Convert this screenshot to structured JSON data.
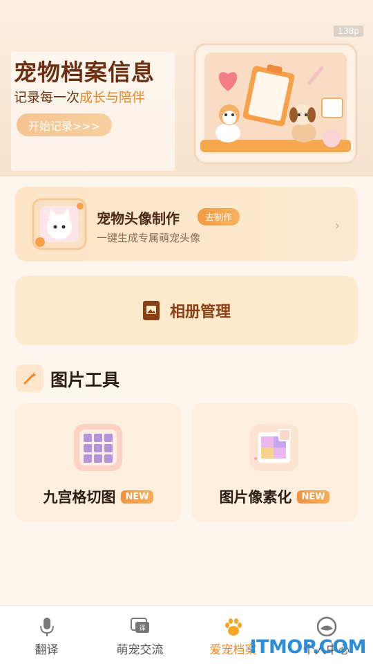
{
  "status": {
    "resolution_badge": "138p"
  },
  "hero": {
    "title": "宠物档案信息",
    "subtitle_prefix": "记录每一次",
    "subtitle_highlight": "成长与陪伴",
    "start_button": "开始记录>>>"
  },
  "avatar_card": {
    "title": "宠物头像制作",
    "tag": "去制作",
    "description": "一键生成专属萌宠头像"
  },
  "album": {
    "label": "相册管理"
  },
  "tools": {
    "title": "图片工具",
    "items": [
      {
        "name": "九宫格切图",
        "badge": "NEW"
      },
      {
        "name": "图片像素化",
        "badge": "NEW"
      }
    ]
  },
  "nav": {
    "items": [
      {
        "label": "翻译",
        "icon": "microphone-icon"
      },
      {
        "label": "萌宠交流",
        "icon": "chat-translate-icon"
      },
      {
        "label": "爱宠档案",
        "icon": "paw-icon",
        "active": true
      },
      {
        "label": "个人中心",
        "icon": "profile-icon"
      }
    ]
  },
  "watermark": "ITMOP.COM",
  "colors": {
    "accent": "#f08a20",
    "brown": "#6b2f12"
  }
}
